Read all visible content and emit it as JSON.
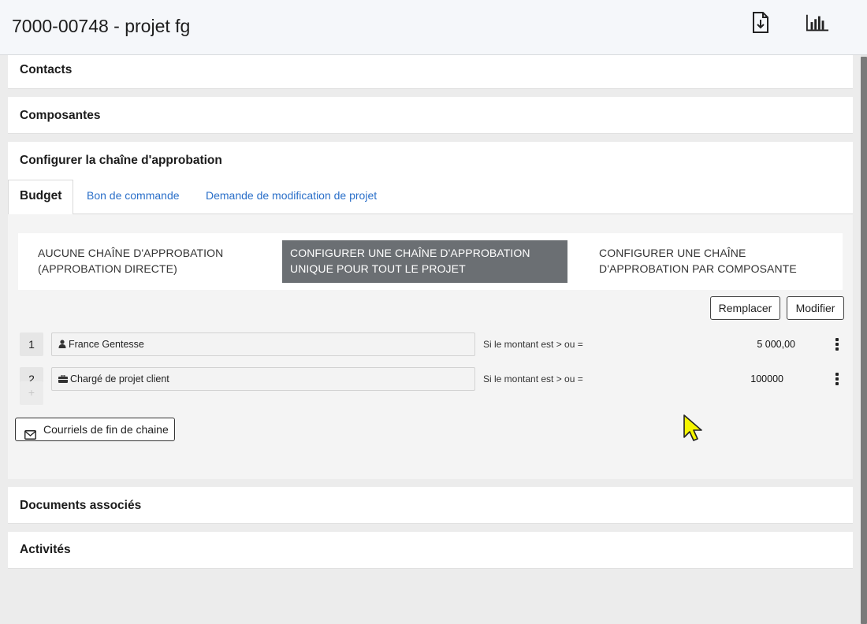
{
  "header": {
    "title": "7000-00748 - projet fg",
    "icons": [
      "download-file-icon",
      "bar-chart-icon"
    ]
  },
  "sections": {
    "contacts": "Contacts",
    "composantes": "Composantes",
    "approval": "Configurer la chaîne d'approbation",
    "documents": "Documents associés",
    "activites": "Activités"
  },
  "tabs": [
    {
      "label": "Budget",
      "active": true
    },
    {
      "label": "Bon de commande",
      "active": false
    },
    {
      "label": "Demande de modification de projet",
      "active": false
    }
  ],
  "segmented": {
    "options": [
      {
        "line1": "AUCUNE CHAÎNE D'APPROBATION",
        "line2": "(APPROBATION DIRECTE)",
        "selected": false
      },
      {
        "line1": "CONFIGURER UNE CHAÎNE D'APPROBATION",
        "line2": "UNIQUE POUR TOUT LE PROJET",
        "selected": true
      },
      {
        "line1": "CONFIGURER UNE CHAÎNE",
        "line2": "D'APPROBATION PAR COMPOSANTE",
        "selected": false
      }
    ]
  },
  "actions": {
    "replace": "Remplacer",
    "modify": "Modifier"
  },
  "chain": [
    {
      "step": "1",
      "icon": "user-icon",
      "approver": "France Gentesse",
      "condition": "Si le montant est > ou =",
      "amount": "5 000,00"
    },
    {
      "step": "2",
      "icon": "briefcase-icon",
      "approver": "Chargé de projet client",
      "condition": "Si le montant est > ou =",
      "amount": "100000"
    }
  ],
  "add_label": "+",
  "end_emails": {
    "label": "Courriels de fin de chaine",
    "icon": "envelope-icon"
  },
  "colors": {
    "header_bg": "#f5f7fa",
    "tab_link": "#2a6fc9",
    "selected_option_bg": "#6b6f73",
    "page_bg": "#ececec"
  }
}
